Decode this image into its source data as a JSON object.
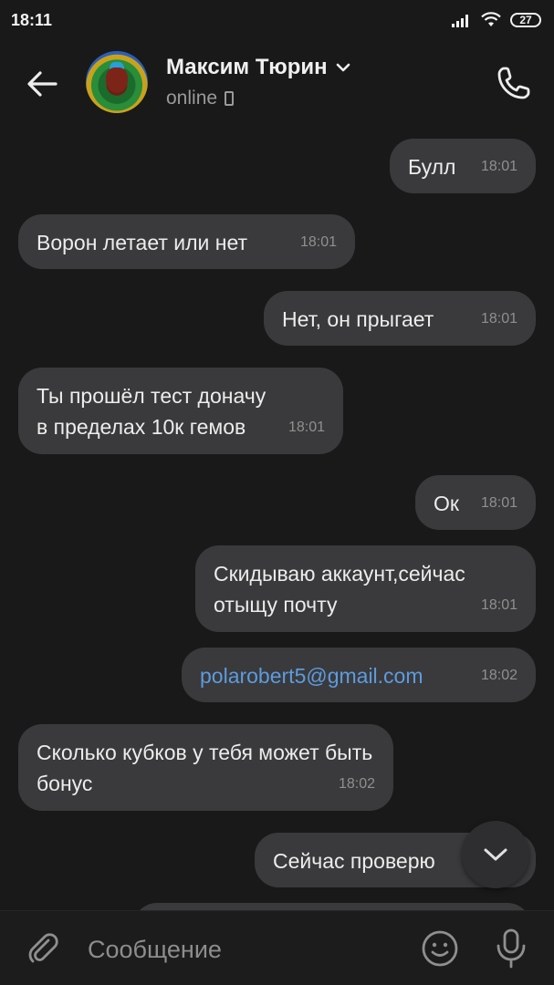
{
  "status_bar": {
    "time": "18:11",
    "battery": "27"
  },
  "header": {
    "contact_name": "Максим Тюрин",
    "status": "online"
  },
  "messages": [
    {
      "direction": "out",
      "text": "Булл",
      "time": "18:01"
    },
    {
      "direction": "in",
      "text": "Ворон летает или нет",
      "time": "18:01"
    },
    {
      "direction": "out",
      "text": "Нет, он прыгает",
      "time": "18:01"
    },
    {
      "direction": "in",
      "text": "Ты прошёл тест доначу в пределах 10к гемов",
      "time": "18:01"
    },
    {
      "direction": "out",
      "text": "Ок",
      "time": "18:01"
    },
    {
      "direction": "out",
      "text": "Скидываю аккаунт,сейчас отыщу почту",
      "time": "18:01"
    },
    {
      "direction": "out",
      "text": "polarobert5@gmail.com",
      "time": "18:02",
      "is_link": true
    },
    {
      "direction": "in",
      "text": "Сколько кубков у тебя может быть бонус",
      "time": "18:02"
    },
    {
      "direction": "out",
      "text": "Сейчас проверю",
      "time": ""
    }
  ],
  "composer": {
    "placeholder": "Сообщение"
  },
  "colors": {
    "background": "#19191a",
    "bubble": "#3a3a3c",
    "link": "#5d9bde",
    "timestamp": "#8f8f8f"
  },
  "icons": [
    "back-arrow-icon",
    "chevron-down-icon",
    "phone-call-icon",
    "paperclip-icon",
    "emoji-icon",
    "microphone-icon",
    "chevron-down-fab-icon"
  ]
}
